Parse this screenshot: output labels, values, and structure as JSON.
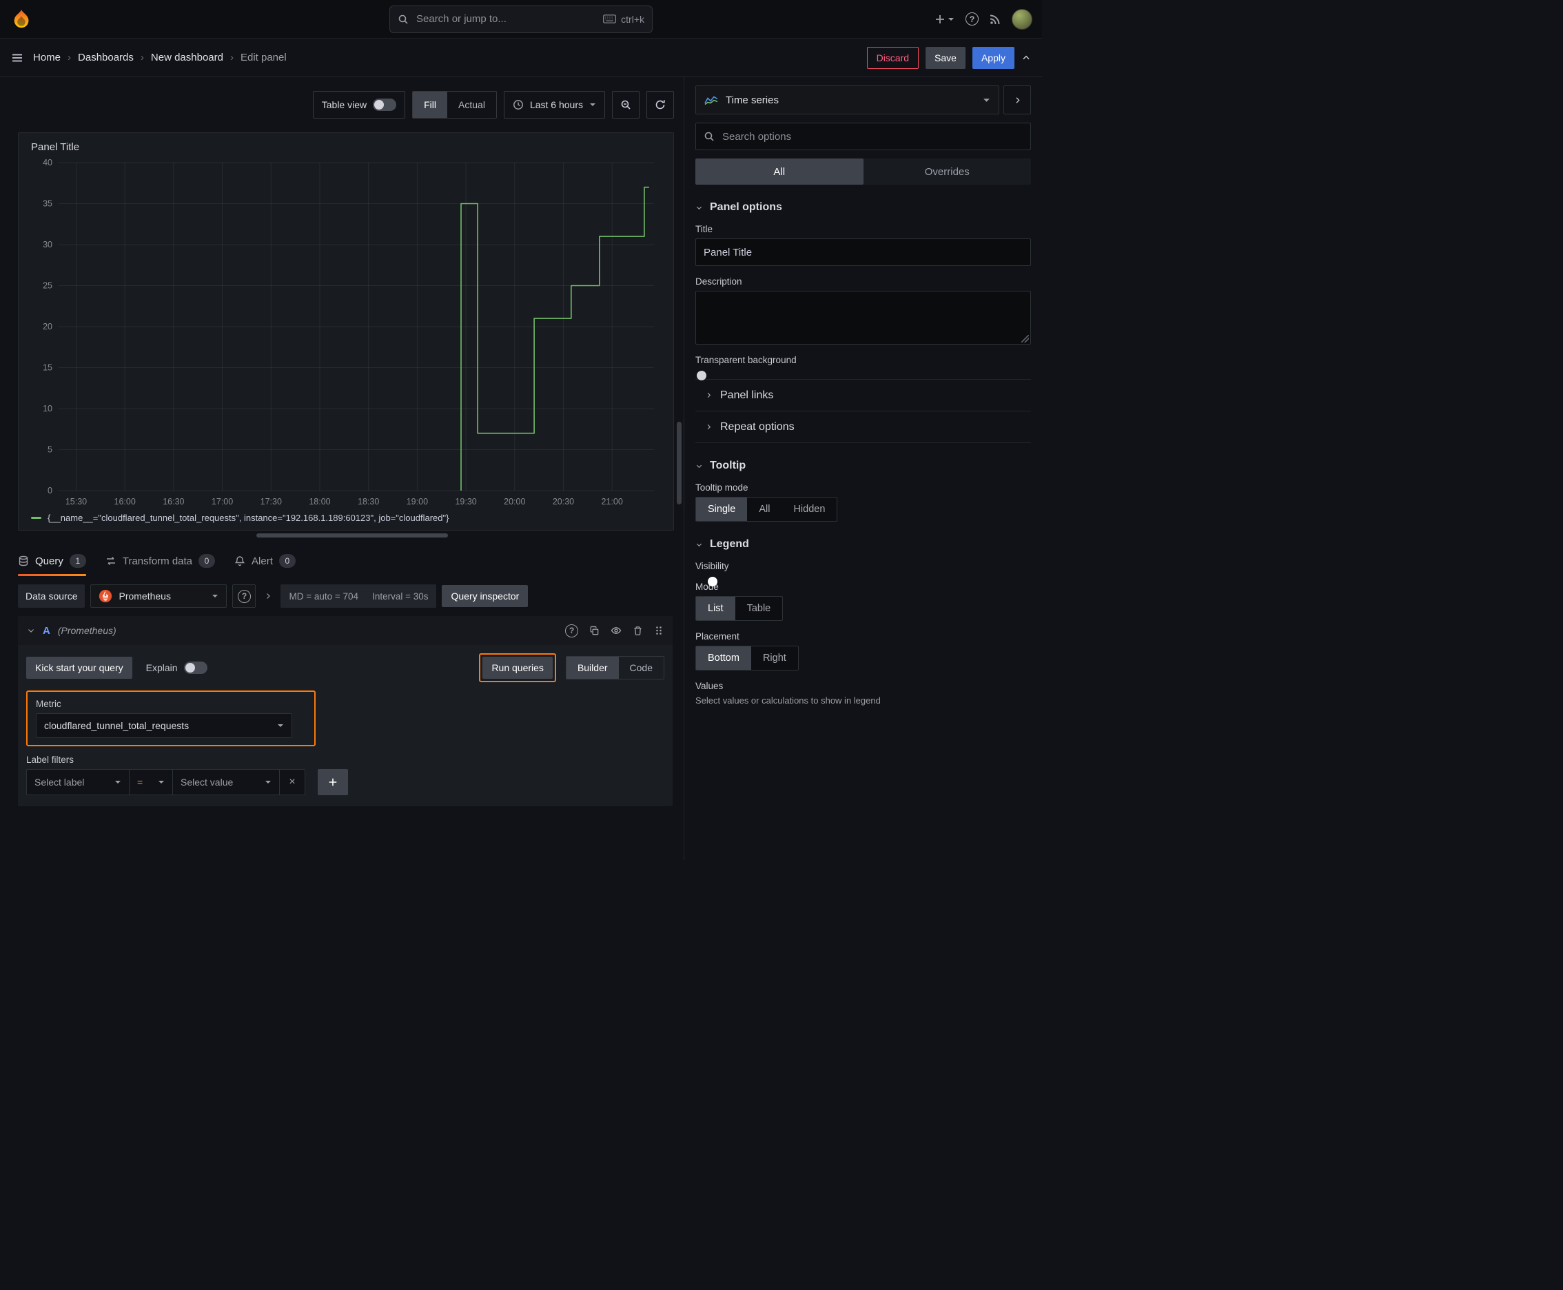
{
  "topbar": {
    "search_placeholder": "Search or jump to...",
    "shortcut": "ctrl+k"
  },
  "breadcrumb": {
    "items": [
      "Home",
      "Dashboards",
      "New dashboard",
      "Edit panel"
    ]
  },
  "actions": {
    "discard": "Discard",
    "save": "Save",
    "apply": "Apply"
  },
  "toolbar": {
    "table_view": "Table view",
    "fill": "Fill",
    "actual": "Actual",
    "time_range": "Last 6 hours"
  },
  "panel": {
    "title": "Panel Title"
  },
  "chart_data": {
    "type": "line",
    "title": "Panel Title",
    "xlim_hours": [
      15.32,
      21.43
    ],
    "ylim": [
      0,
      40
    ],
    "y_ticks": [
      0,
      5,
      10,
      15,
      20,
      25,
      30,
      35,
      40
    ],
    "x_ticks": [
      "15:30",
      "16:00",
      "16:30",
      "17:00",
      "17:30",
      "18:00",
      "18:30",
      "19:00",
      "19:30",
      "20:00",
      "20:30",
      "21:00"
    ],
    "x_tick_hours": [
      15.5,
      16,
      16.5,
      17,
      17.5,
      18,
      18.5,
      19,
      19.5,
      20,
      20.5,
      21
    ],
    "grid": true,
    "legend_position": "bottom",
    "series": [
      {
        "name": "{__name__=\"cloudflared_tunnel_total_requests\", instance=\"192.168.1.189:60123\", job=\"cloudflared\"}",
        "color": "#73bf69",
        "points_hours_value": [
          [
            19.45,
            0
          ],
          [
            19.45,
            35
          ],
          [
            19.62,
            35
          ],
          [
            19.62,
            7
          ],
          [
            20.2,
            7
          ],
          [
            20.2,
            21
          ],
          [
            20.58,
            21
          ],
          [
            20.58,
            25
          ],
          [
            20.87,
            25
          ],
          [
            20.87,
            31
          ],
          [
            21.33,
            31
          ],
          [
            21.33,
            37
          ],
          [
            21.38,
            37
          ]
        ]
      }
    ]
  },
  "tabs": [
    {
      "label": "Query",
      "badge": "1"
    },
    {
      "label": "Transform data",
      "badge": "0"
    },
    {
      "label": "Alert",
      "badge": "0"
    }
  ],
  "query": {
    "datasource_label": "Data source",
    "datasource_value": "Prometheus",
    "stats": "MD = auto = 704",
    "interval": "Interval = 30s",
    "inspector_label": "Query inspector",
    "ref_id": "A",
    "ref_note": "(Prometheus)",
    "kickstart_label": "Kick start your query",
    "explain_label": "Explain",
    "run_label": "Run queries",
    "builder_label": "Builder",
    "code_label": "Code",
    "metric_label": "Metric",
    "metric_value": "cloudflared_tunnel_total_requests",
    "label_filters_label": "Label filters",
    "select_label_placeholder": "Select label",
    "operator": "=",
    "select_value_placeholder": "Select value"
  },
  "options": {
    "viz_type": "Time series",
    "search_placeholder": "Search options",
    "tabs": {
      "all": "All",
      "overrides": "Overrides"
    },
    "panel_options": {
      "title": "Panel options",
      "title_label": "Title",
      "title_value": "Panel Title",
      "description_label": "Description",
      "transparent_label": "Transparent background"
    },
    "panel_links": "Panel links",
    "repeat_options": "Repeat options",
    "tooltip": {
      "title": "Tooltip",
      "mode_label": "Tooltip mode",
      "modes": [
        "Single",
        "All",
        "Hidden"
      ],
      "active_mode": "Single"
    },
    "legend": {
      "title": "Legend",
      "visibility_label": "Visibility",
      "mode_label": "Mode",
      "modes": [
        "List",
        "Table"
      ],
      "active_mode": "List",
      "placement_label": "Placement",
      "placements": [
        "Bottom",
        "Right"
      ],
      "active_placement": "Bottom",
      "values_label": "Values",
      "values_help": "Select values or calculations to show in legend"
    }
  },
  "colors": {
    "accent_blue": "#3d71d9",
    "annotation_orange": "#ff780a",
    "series_green": "#73bf69",
    "destructive_red": "#f2495c",
    "tab_underline": "#f05a28"
  }
}
